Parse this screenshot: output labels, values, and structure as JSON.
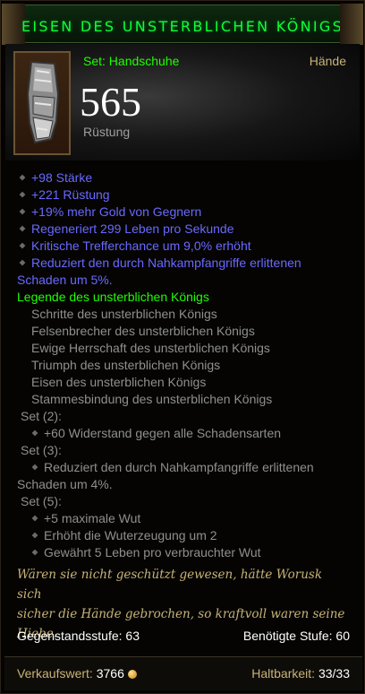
{
  "title": "EISEN DES UNSTERBLICHEN KÖNIGS",
  "item": {
    "set_type": "Set: Handschuhe",
    "slot": "Hände",
    "armor_value": "565",
    "armor_label": "Rüstung",
    "icon": "gauntlet-icon"
  },
  "primary_affixes": [
    "+98 Stärke",
    "+221 Rüstung",
    "+19% mehr Gold von Gegnern",
    "Regeneriert 299 Leben pro Sekunde",
    "Kritische Trefferchance um 9,0% erhöht",
    "Reduziert den durch Nahkampfangriffe erlittenen",
    "Schaden um 5%."
  ],
  "set": {
    "name": "Legende des unsterblichen Königs",
    "items": [
      "Schritte des unsterblichen Königs",
      "Felsenbrecher des unsterblichen Königs",
      "Ewige Herrschaft des unsterblichen Königs",
      "Triumph des unsterblichen Königs",
      "Eisen des unsterblichen Königs",
      "Stammesbindung des unsterblichen Königs"
    ],
    "bonus2_label": "Set (2):",
    "bonus2": "+60 Widerstand gegen alle Schadensarten",
    "bonus3_label": "Set (3):",
    "bonus3_line1": "Reduziert den durch Nahkampfangriffe erlittenen",
    "bonus3_line2": "Schaden um 4%.",
    "bonus5_label": "Set (5):",
    "bonus5": [
      "+5 maximale Wut",
      "Erhöht die Wuterzeugung um 2",
      "Gewährt 5 Leben pro verbrauchter Wut"
    ]
  },
  "flavor": [
    "Wären sie nicht geschützt gewesen, hätte Worusk sich",
    "sicher die Hände gebrochen, so kraftvoll waren seine",
    "Hiebe."
  ],
  "item_level": "Gegenstandsstufe: 63",
  "required_level": "Benötigte Stufe: 60",
  "sell_label": "Verkaufswert:",
  "sell_value": "3766",
  "durability_label": "Haltbarkeit:",
  "durability_value": "33/33",
  "colors": {
    "title_green": "#0cff3a",
    "set_green": "#1eff00",
    "magic_blue": "#6969ff",
    "gold": "#c7b377",
    "grey": "#8f8f8f"
  }
}
